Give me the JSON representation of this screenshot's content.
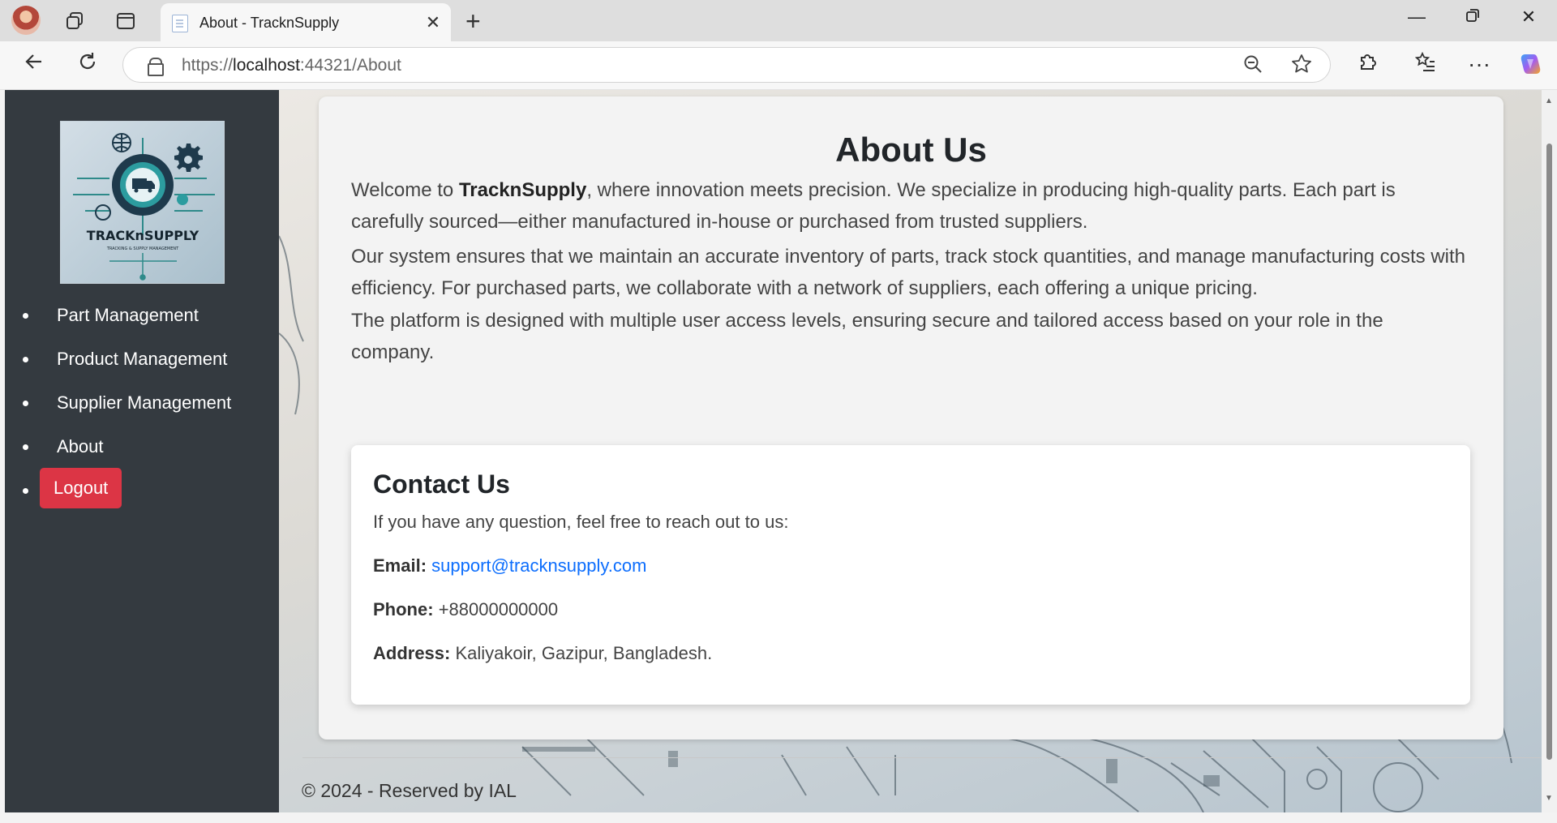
{
  "browser": {
    "tab_title": "About - TracknSupply",
    "url_prefix": "https://",
    "url_host": "localhost",
    "url_rest": ":44321/About"
  },
  "sidebar": {
    "logo_title": "TRACKnSUPPLY",
    "logo_subtitle": "TRACKING & SUPPLY MANAGEMENT",
    "items": [
      {
        "label": "Part Management"
      },
      {
        "label": "Product Management"
      },
      {
        "label": "Supplier Management"
      },
      {
        "label": "About"
      }
    ],
    "logout_label": "Logout"
  },
  "about": {
    "title": "About Us",
    "p1_pre": "Welcome to ",
    "p1_brand": "TracknSupply",
    "p1_post": ", where innovation meets precision. We specialize in producing high-quality parts. Each part is carefully sourced—either manufactured in-house or purchased from trusted suppliers.",
    "p2": "Our system ensures that we maintain an accurate inventory of parts, track stock quantities, and manage manufacturing costs with efficiency. For purchased parts, we collaborate with a network of suppliers, each offering a unique pricing.",
    "p3": "The platform is designed with multiple user access levels, ensuring secure and tailored access based on your role in the company."
  },
  "contact": {
    "title": "Contact Us",
    "intro": "If you have any question, feel free to reach out to us:",
    "email_label": "Email:",
    "email": "support@tracknsupply.com",
    "phone_label": "Phone:",
    "phone": "+88000000000",
    "address_label": "Address:",
    "address": "Kaliyakoir, Gazipur, Bangladesh."
  },
  "footer": {
    "text": "© 2024 - Reserved by IAL"
  },
  "colors": {
    "sidebar_bg": "#343a40",
    "logout_bg": "#dc3545",
    "link": "#0d6efd"
  }
}
